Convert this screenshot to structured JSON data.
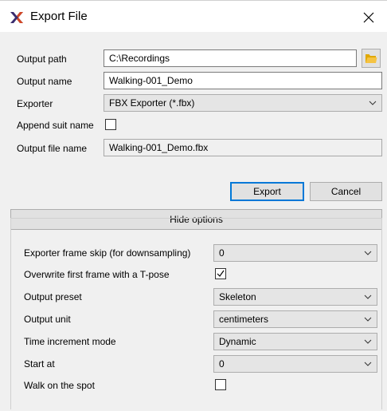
{
  "window": {
    "title": "Export File",
    "logo_icon": "x-logo-icon",
    "logo_color": "#3a2c6e",
    "logo_accent": "#d24726"
  },
  "form": {
    "output_path_label": "Output path",
    "output_path_value": "C:\\Recordings",
    "output_name_label": "Output name",
    "output_name_value": "Walking-001_Demo",
    "exporter_label": "Exporter",
    "exporter_value": "FBX Exporter (*.fbx)",
    "append_suit_label": "Append suit name",
    "append_suit_checked": false,
    "output_file_label": "Output file name",
    "output_file_value": "Walking-001_Demo.fbx"
  },
  "buttons": {
    "export": "Export",
    "cancel": "Cancel",
    "hide_options": "Hide options"
  },
  "options": {
    "frame_skip_label": "Exporter frame skip (for downsampling)",
    "frame_skip_value": "0",
    "overwrite_tpose_label": "Overwrite first frame with a T-pose",
    "overwrite_tpose_checked": true,
    "output_preset_label": "Output preset",
    "output_preset_value": "Skeleton",
    "output_unit_label": "Output unit",
    "output_unit_value": "centimeters",
    "time_increment_label": "Time increment mode",
    "time_increment_value": "Dynamic",
    "start_at_label": "Start at",
    "start_at_value": "0",
    "walk_on_spot_label": "Walk on the spot",
    "walk_on_spot_checked": false
  },
  "colors": {
    "accent": "#0078d7",
    "folder": "#f5c342"
  }
}
